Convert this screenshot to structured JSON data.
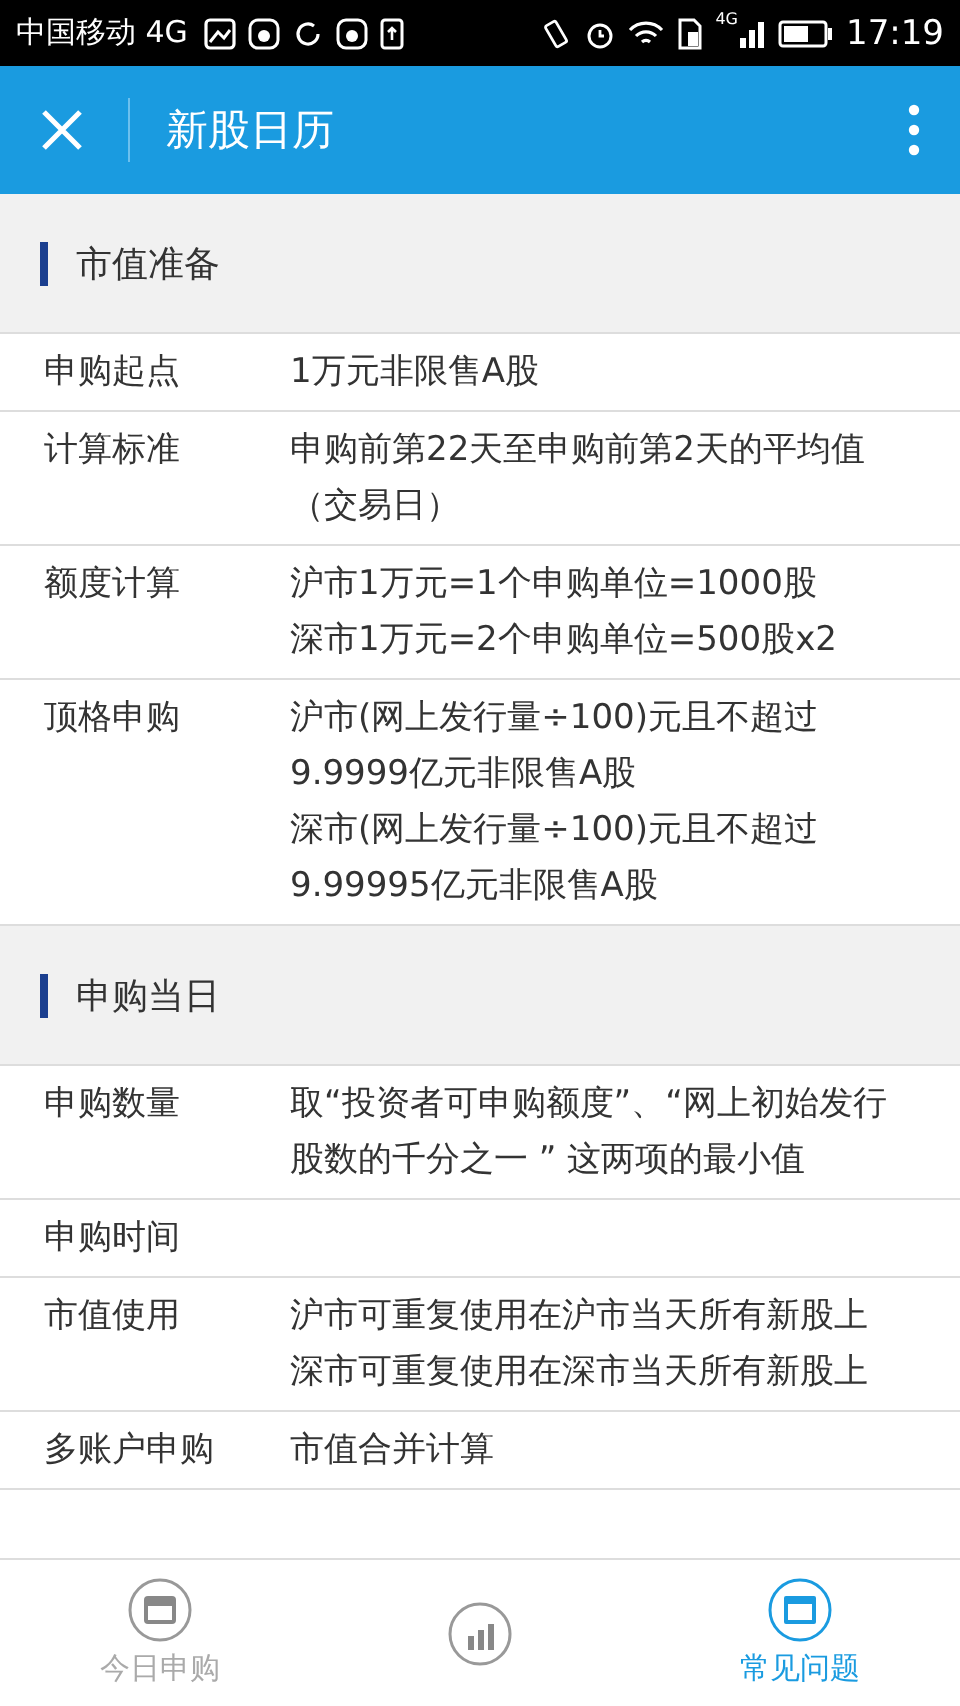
{
  "status_bar": {
    "carrier": "中国移动 4G",
    "network_badge": "4G",
    "time": "17:19"
  },
  "header": {
    "title": "新股日历"
  },
  "sections": [
    {
      "title": "市值准备",
      "rows": [
        {
          "label": "申购起点",
          "lines": [
            "1万元非限售A股"
          ]
        },
        {
          "label": "计算标准",
          "lines": [
            "申购前第22天至申购前第2天的平均值（交易日）"
          ]
        },
        {
          "label": "额度计算",
          "lines": [
            "沪市1万元=1个申购单位=1000股",
            "深市1万元=2个申购单位=500股x2"
          ]
        },
        {
          "label": "顶格申购",
          "lines": [
            "沪市(网上发行量÷100)元且不超过9.9999亿元非限售A股",
            "深市(网上发行量÷100)元且不超过9.99995亿元非限售A股"
          ]
        }
      ]
    },
    {
      "title": "申购当日",
      "rows": [
        {
          "label": "申购数量",
          "lines": [
            "取“投资者可申购额度”、“网上初始发行股数的千分之一 ” 这两项的最小值"
          ]
        },
        {
          "label": "申购时间",
          "lines": []
        },
        {
          "label": "市值使用",
          "lines": [
            "沪市可重复使用在沪市当天所有新股上",
            "深市可重复使用在深市当天所有新股上"
          ]
        },
        {
          "label": "多账户申购",
          "lines": [
            "市值合并计算"
          ]
        }
      ]
    }
  ],
  "tabs": [
    {
      "kind": "calendar",
      "label": "今日申购",
      "selected": false
    },
    {
      "kind": "chart",
      "selected": false
    },
    {
      "kind": "faq",
      "label": "常见问题",
      "selected": true
    }
  ]
}
